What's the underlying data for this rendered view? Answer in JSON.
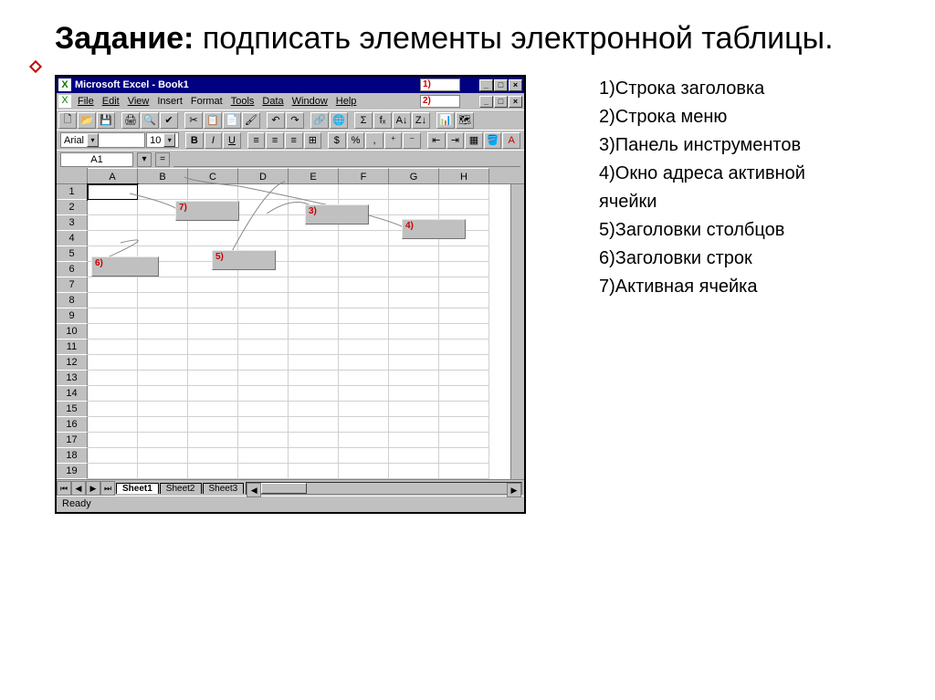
{
  "heading": {
    "bold": "Задание:",
    "rest": " подписать элементы электронной таблицы."
  },
  "window": {
    "title": "Microsoft Excel - Book1",
    "menus": [
      "File",
      "Edit",
      "View",
      "Insert",
      "Format",
      "Tools",
      "Data",
      "Window",
      "Help"
    ],
    "font_name": "Arial",
    "font_size": "10",
    "active_cell": "A1",
    "columns": [
      "A",
      "B",
      "C",
      "D",
      "E",
      "F",
      "G",
      "H"
    ],
    "row_count": 19,
    "sheets": [
      "Sheet1",
      "Sheet2",
      "Sheet3"
    ],
    "status": "Ready"
  },
  "callouts": {
    "c1": "1)",
    "c2": "2)",
    "c3": "3)",
    "c4": "4)",
    "c5": "5)",
    "c6": "6)",
    "c7": "7)"
  },
  "toolbar_icons": {
    "new": "🗋",
    "open": "📂",
    "save": "💾",
    "print": "🖨",
    "preview": "🔍",
    "spell": "✔",
    "cut": "✂",
    "copy": "📋",
    "paste": "📄",
    "fmtpaint": "🖌",
    "undo": "↶",
    "redo": "↷",
    "link": "🔗",
    "web": "🌐",
    "sum": "Σ",
    "fx": "fₓ",
    "sortaz": "A↓",
    "sortza": "Z↓",
    "chart": "📊",
    "map": "🗺"
  },
  "fmt_icons": {
    "bold": "B",
    "italic": "I",
    "underline": "U",
    "left": "≡",
    "center": "≡",
    "right": "≡",
    "merge": "⊞",
    "currency": "$",
    "percent": "%",
    "comma": ",",
    "decinc": "⁺",
    "decdec": "⁻",
    "indout": "⇤",
    "indin": "⇥",
    "border": "▦",
    "fill": "🪣",
    "font": "A"
  },
  "answers": [
    "1)Строка заголовка",
    "2)Строка меню",
    "3)Панель инструментов",
    "4)Окно адреса активной ячейки",
    "5)Заголовки столбцов",
    "6)Заголовки строк",
    "7)Активная ячейка"
  ]
}
